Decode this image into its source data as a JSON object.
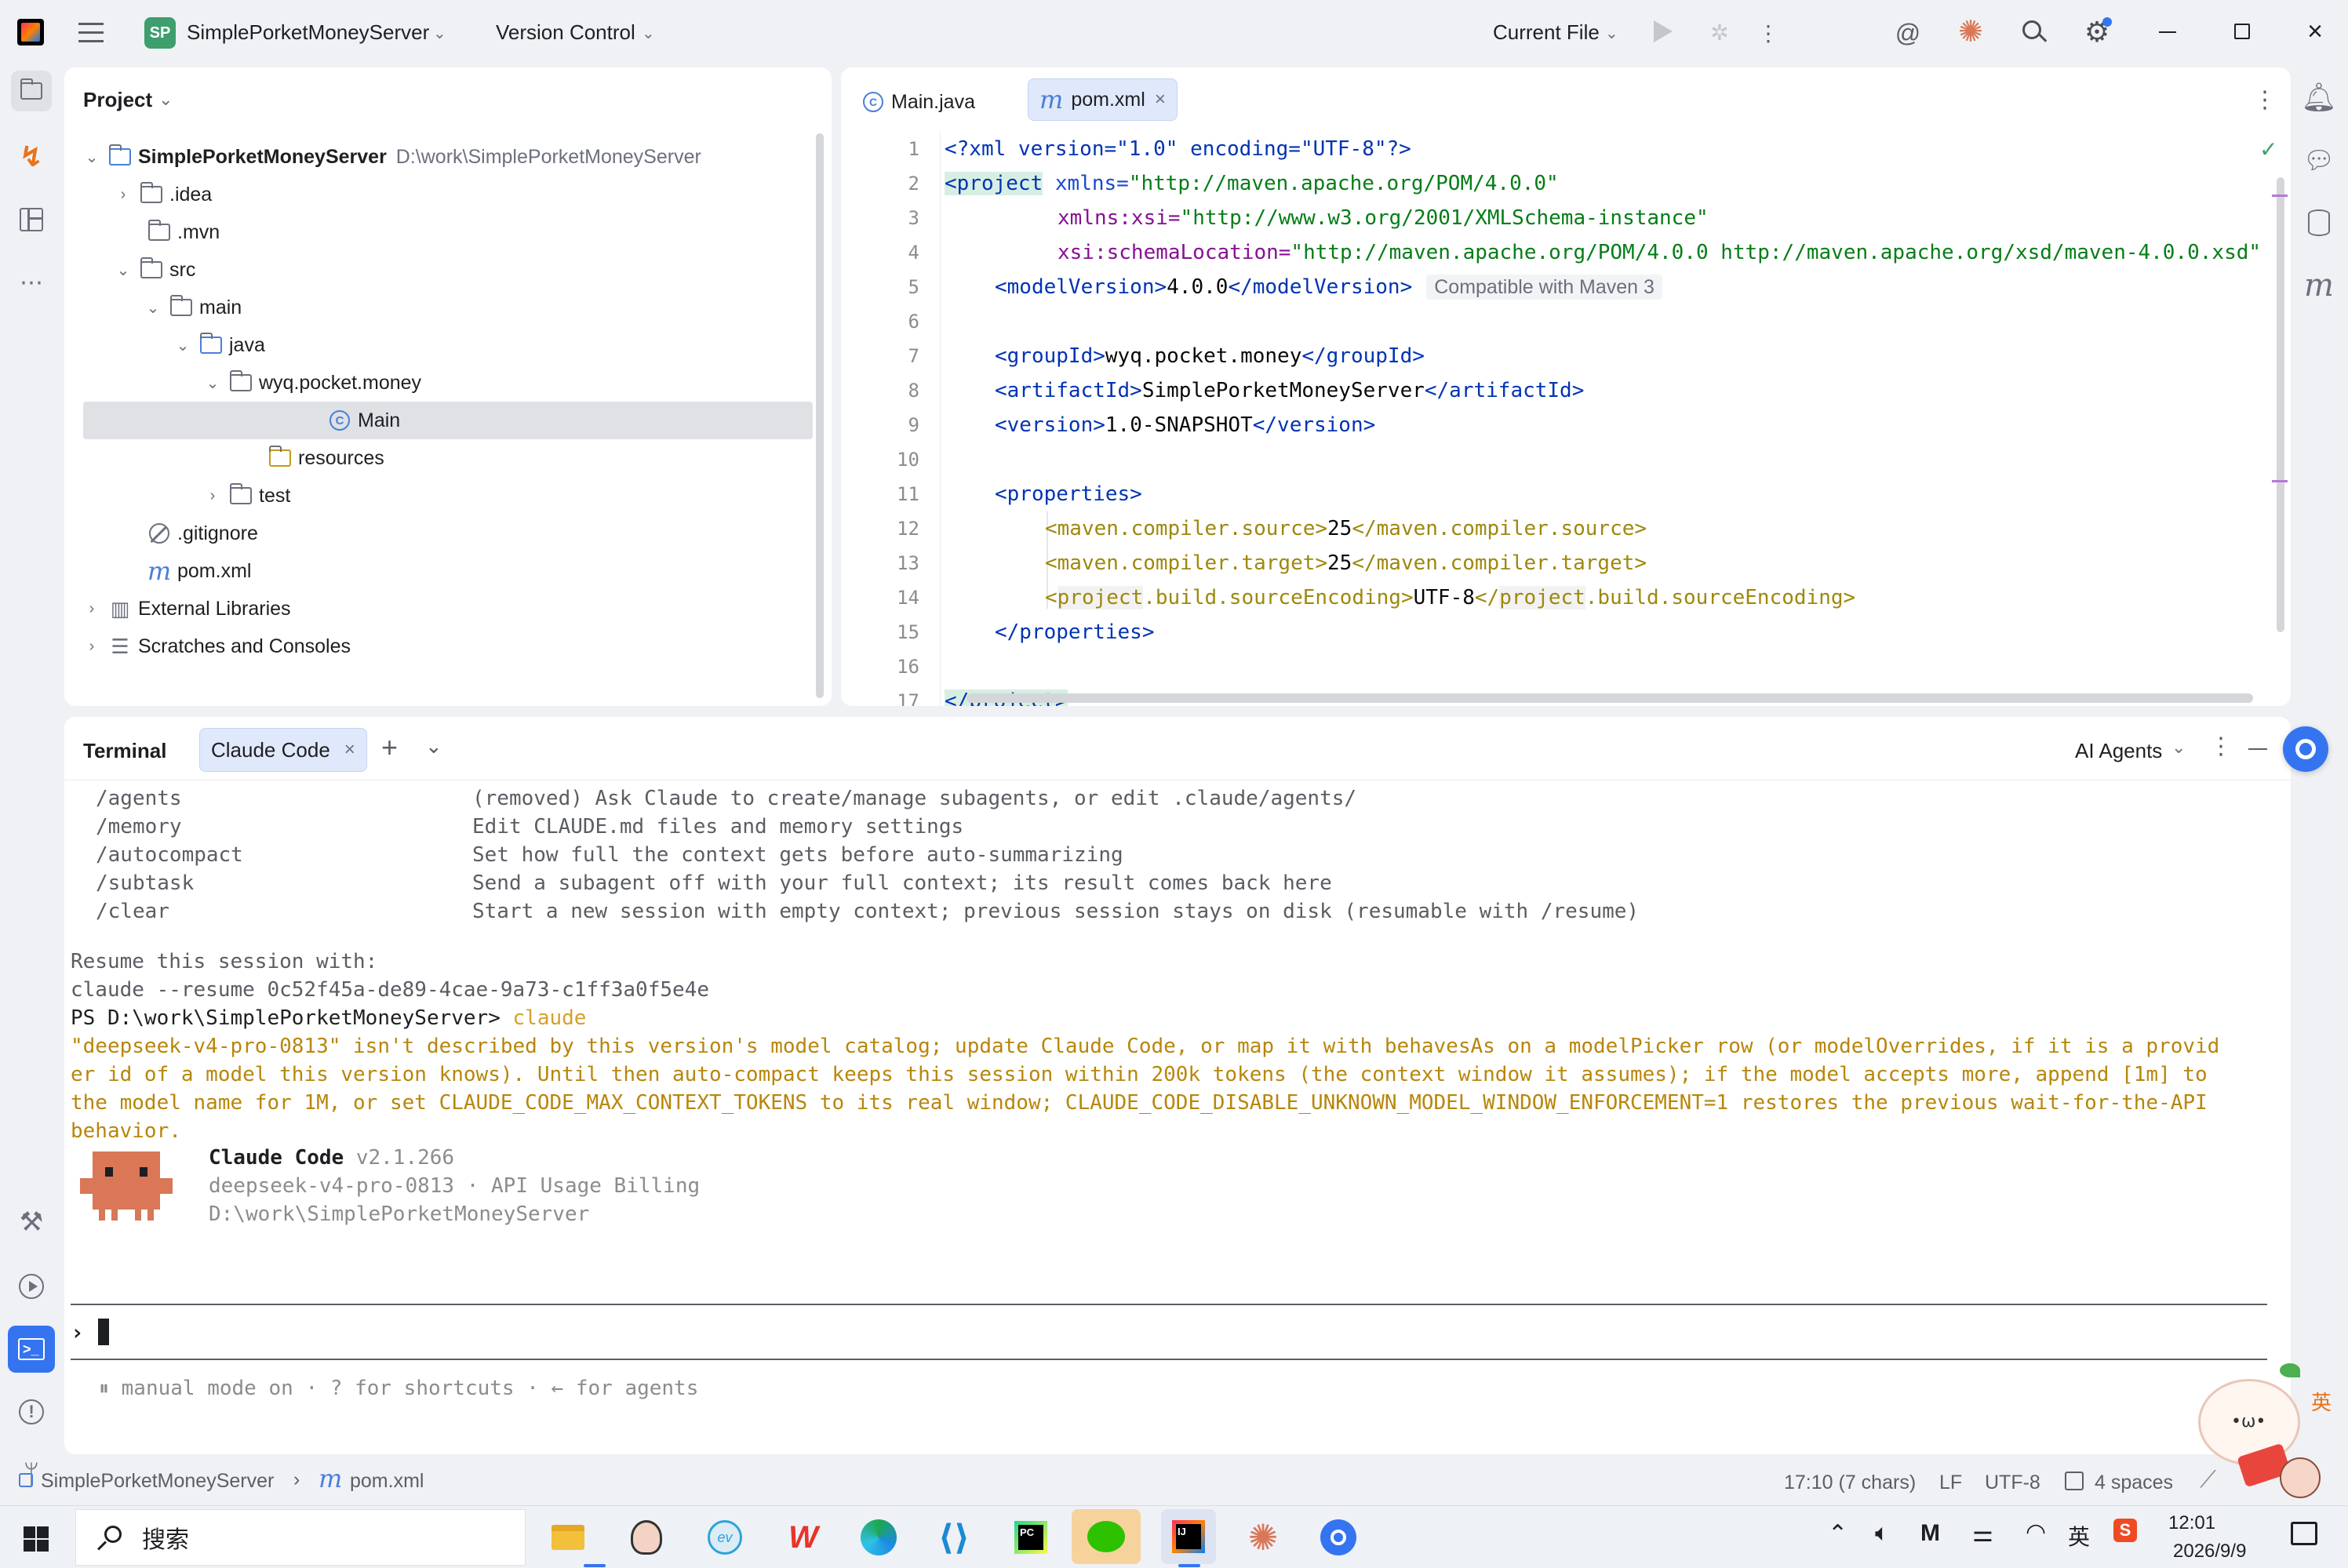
{
  "window": {
    "logo_text": "SP",
    "project_name": "SimplePorketMoneyServer",
    "vcs_label": "Version Control",
    "run_config": "Current File"
  },
  "project_panel": {
    "title": "Project",
    "tree": [
      {
        "label": "SimplePorketMoneyServer",
        "path": "D:\\work\\SimplePorketMoneyServer",
        "bold": true
      },
      {
        "label": ".idea"
      },
      {
        "label": ".mvn"
      },
      {
        "label": "src"
      },
      {
        "label": "main"
      },
      {
        "label": "java"
      },
      {
        "label": "wyq.pocket.money"
      },
      {
        "label": "Main"
      },
      {
        "label": "resources"
      },
      {
        "label": "test"
      },
      {
        "label": ".gitignore"
      },
      {
        "label": "pom.xml"
      },
      {
        "label": "External Libraries"
      },
      {
        "label": "Scratches and Consoles"
      }
    ]
  },
  "editor": {
    "tabs": [
      {
        "label": "Main.java",
        "active": false
      },
      {
        "label": "pom.xml",
        "active": true
      }
    ],
    "line_numbers": [
      "1",
      "2",
      "3",
      "4",
      "5",
      "6",
      "7",
      "8",
      "9",
      "10",
      "11",
      "12",
      "13",
      "14",
      "15",
      "16",
      "17"
    ],
    "lines": {
      "l1": "<?xml version=\"1.0\" encoding=\"UTF-8\"?>",
      "l2a": "<project",
      "l2b": " xmlns=",
      "l2c": "\"http://maven.apache.org/POM/4.0.0\"",
      "l3a": "xmlns:xsi=",
      "l3b": "\"http://www.w3.org/2001/XMLSchema-instance\"",
      "l4a": "xsi:schemaLocation=",
      "l4b": "\"http://maven.apache.org/POM/4.0.0 http://maven.apache.org/xsd/maven-4.0.0.xsd\"",
      "l5a": "<modelVersion>",
      "l5b": "4.0.0",
      "l5c": "</modelVersion>",
      "l5hint": "Compatible with Maven 3",
      "l7a": "<groupId>",
      "l7b": "wyq.pocket.money",
      "l7c": "</groupId>",
      "l8a": "<artifactId>",
      "l8b": "SimplePorketMoneyServer",
      "l8c": "</artifactId>",
      "l9a": "<version>",
      "l9b": "1.0-SNAPSHOT",
      "l9c": "</version>",
      "l11": "<properties>",
      "l12a": "<maven.compiler.source>",
      "l12b": "25",
      "l12c": "</maven.compiler.source>",
      "l13a": "<maven.compiler.target>",
      "l13b": "25",
      "l13c": "</maven.compiler.target>",
      "l14a": "<",
      "l14b": "project",
      "l14c": ".build.sourceEncoding>",
      "l14d": "UTF-8",
      "l14e": "</",
      "l14f": "project",
      "l14g": ".build.sourceEncoding>",
      "l15": "</properties>",
      "l17": "</project>"
    }
  },
  "terminal": {
    "tab_title": "Terminal",
    "session_tab": "Claude Code",
    "agents_label": "AI Agents",
    "commands": [
      {
        "cmd": "/agents",
        "desc": "(removed) Ask Claude to create/manage subagents, or edit .claude/agents/"
      },
      {
        "cmd": "/memory",
        "desc": "Edit CLAUDE.md files and memory settings"
      },
      {
        "cmd": "/autocompact",
        "desc": "Set how full the context gets before auto-summarizing"
      },
      {
        "cmd": "/subtask",
        "desc": "Send a subagent off with your full context; its result comes back here"
      },
      {
        "cmd": "/clear",
        "desc": "Start a new session with empty context; previous session stays on disk (resumable with /resume)"
      }
    ],
    "resume_label": "Resume this session with:",
    "resume_cmd": "claude --resume 0c52f45a-de89-4cae-9a73-c1ff3a0f5e4e",
    "prompt": "PS D:\\work\\SimplePorketMoneyServer> ",
    "prompt_cmd": "claude",
    "warning": [
      "\"deepseek-v4-pro-0813\" isn't described by this version's model catalog; update Claude Code, or map it with behavesAs on a modelPicker row (or modelOverrides, if it is a provid",
      "er id of a model this version knows). Until then auto-compact keeps this session within 200k tokens (the context window it assumes); if the model accepts more, append [1m] to",
      "the model name for 1M, or set CLAUDE_CODE_MAX_CONTEXT_TOKENS to its real window; CLAUDE_CODE_DISABLE_UNKNOWN_MODEL_WINDOW_ENFORCEMENT=1 restores the previous wait-for-the-API",
      "behavior."
    ],
    "cc_name": "Claude Code",
    "cc_version": "v2.1.266",
    "cc_model": "deepseek-v4-pro-0813 · API Usage Billing",
    "cc_path": "D:\\work\\SimplePorketMoneyServer",
    "input_prompt": "›",
    "footer_hint": "⏸ manual mode on · ? for shortcuts · ← for agents"
  },
  "statusbar": {
    "crumb_project": "SimplePorketMoneyServer",
    "crumb_file": "pom.xml",
    "position": "17:10 (7 chars)",
    "line_sep": "LF",
    "encoding": "UTF-8",
    "indent": "4 spaces"
  },
  "taskbar": {
    "search_placeholder": "搜索",
    "time": "12:01",
    "date": "2026/9/9",
    "ime": "英"
  },
  "colors": {
    "accent": "#3574f0",
    "claude_orange": "#d97757",
    "warning_text": "#b8860b"
  }
}
